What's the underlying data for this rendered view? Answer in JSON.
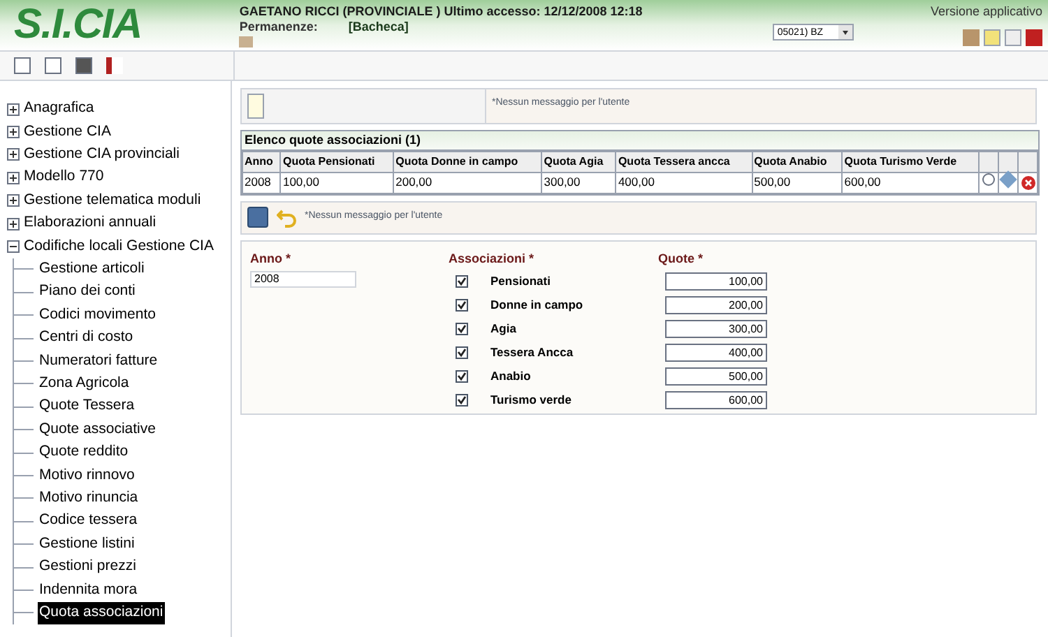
{
  "header": {
    "logo": "S.I.CIA",
    "user_line": "GAETANO RICCI (PROVINCIALE ) Ultimo accesso: 12/12/2008 12:18",
    "permanenze_label": "Permanenze:",
    "permanenze_value": "[Bacheca]",
    "office_select": "05021) BZ",
    "version": "Versione applicativo"
  },
  "sidebar": {
    "items": [
      {
        "label": "Anagrafica",
        "expanded": false,
        "selected": false
      },
      {
        "label": "Gestione CIA",
        "expanded": false,
        "selected": false
      },
      {
        "label": "Gestione CIA provinciali",
        "expanded": false,
        "selected": false
      },
      {
        "label": "Modello 770",
        "expanded": false,
        "selected": false
      },
      {
        "label": "Gestione telematica moduli",
        "expanded": false,
        "selected": false
      },
      {
        "label": "Elaborazioni annuali",
        "expanded": false,
        "selected": false
      },
      {
        "label": "Codifiche locali Gestione CIA",
        "expanded": true,
        "selected": false,
        "children": [
          {
            "label": "Gestione articoli",
            "selected": false
          },
          {
            "label": "Piano dei conti",
            "selected": false
          },
          {
            "label": "Codici movimento",
            "selected": false
          },
          {
            "label": "Centri di costo",
            "selected": false
          },
          {
            "label": "Numeratori fatture",
            "selected": false
          },
          {
            "label": "Zona Agricola",
            "selected": false
          },
          {
            "label": "Quote Tessera",
            "selected": false
          },
          {
            "label": "Quote associative",
            "selected": false
          },
          {
            "label": "Quote reddito",
            "selected": false
          },
          {
            "label": "Motivo rinnovo",
            "selected": false
          },
          {
            "label": "Motivo rinuncia",
            "selected": false
          },
          {
            "label": "Codice tessera",
            "selected": false
          },
          {
            "label": "Gestione listini",
            "selected": false
          },
          {
            "label": "Gestioni prezzi",
            "selected": false
          },
          {
            "label": "Indennita mora",
            "selected": false
          },
          {
            "label": "Quota associazioni",
            "selected": true
          }
        ]
      }
    ]
  },
  "top_message": "*Nessun messaggio per l'utente",
  "table": {
    "title": "Elenco quote associazioni (1)",
    "columns": [
      "Anno",
      "Quota Pensionati",
      "Quota Donne in campo",
      "Quota Agia",
      "Quota Tessera ancca",
      "Quota Anabio",
      "Quota Turismo Verde"
    ],
    "rows": [
      [
        "2008",
        "100,00",
        "200,00",
        "300,00",
        "400,00",
        "500,00",
        "600,00"
      ]
    ]
  },
  "form_message": "*Nessun messaggio per l'utente",
  "form": {
    "anno_label": "Anno *",
    "anno_value": "2008",
    "associazioni_label": "Associazioni *",
    "quote_label": "Quote *",
    "associazioni": [
      {
        "name": "Pensionati",
        "checked": true,
        "quota": "100,00"
      },
      {
        "name": "Donne in campo",
        "checked": true,
        "quota": "200,00"
      },
      {
        "name": "Agia",
        "checked": true,
        "quota": "300,00"
      },
      {
        "name": "Tessera Ancca",
        "checked": true,
        "quota": "400,00"
      },
      {
        "name": "Anabio",
        "checked": true,
        "quota": "500,00"
      },
      {
        "name": "Turismo verde",
        "checked": true,
        "quota": "600,00"
      }
    ]
  }
}
